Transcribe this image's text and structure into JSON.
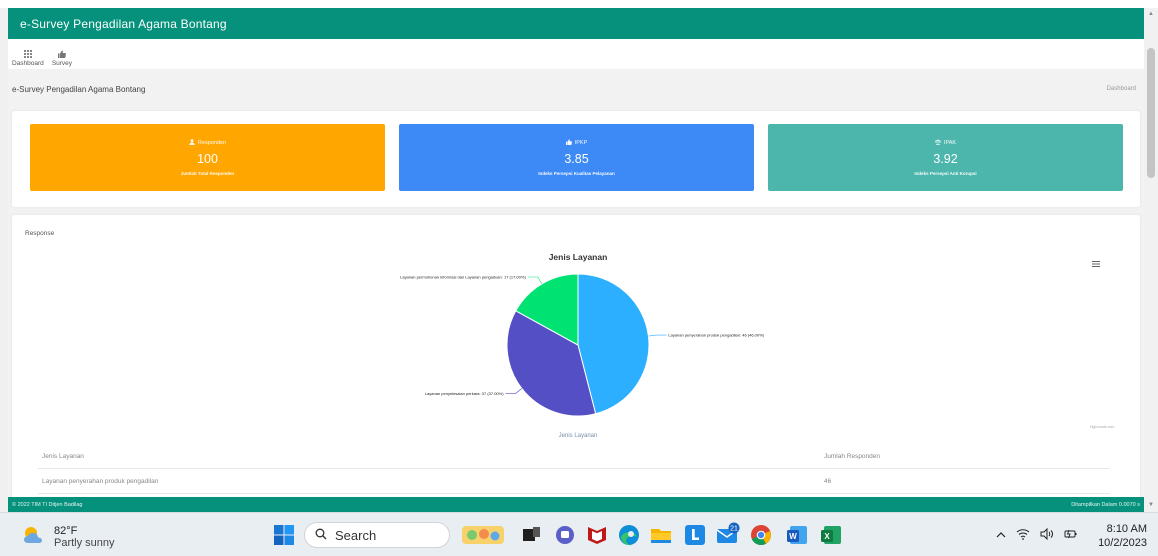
{
  "app": {
    "title": "e-Survey Pengadilan Agama Bontang"
  },
  "nav": {
    "items": [
      {
        "label": "Dashboard",
        "icon": "grid-icon"
      },
      {
        "label": "Survey",
        "icon": "thumbs-up-icon"
      }
    ]
  },
  "page": {
    "title": "e-Survey Pengadilan Agama Bontang",
    "breadcrumb": "Dashboard"
  },
  "stats": [
    {
      "heading": "Responden",
      "value": "100",
      "subtitle": "Jumlah Total Responden",
      "color": "#ffa700",
      "icon": "user-icon"
    },
    {
      "heading": "IPKP",
      "value": "3.85",
      "subtitle": "Indeks Persepsi Kualitas Pelayanan",
      "color": "#3d8af7",
      "icon": "thumbs-up-icon"
    },
    {
      "heading": "IPAK",
      "value": "3.92",
      "subtitle": "Indeks Persepsi Anti Korupsi",
      "color": "#4db6ac",
      "icon": "balance-icon"
    }
  ],
  "response": {
    "card_title": "Response",
    "credit": "Highcharts.com"
  },
  "chart_data": {
    "type": "pie",
    "title": "Jenis Layanan",
    "xlabel": "Jenis Layanan",
    "slices": [
      {
        "label": "Layanan penyerahan produk pengadilan: 46 (46.00%)",
        "name": "Layanan penyerahan produk pengadilan",
        "value": 46,
        "percent": 46.0,
        "color": "#2caffe"
      },
      {
        "label": "Layanan penyelesaian perkara: 37 (37.00%)",
        "name": "Layanan penyelesaian perkara",
        "value": 37,
        "percent": 37.0,
        "color": "#544fc5"
      },
      {
        "label": "Layanan permohonan informasi dan Layanan pengaduan: 17 (17.00%)",
        "name": "Layanan permohonan informasi dan Layanan pengaduan",
        "value": 17,
        "percent": 17.0,
        "color": "#00e272"
      }
    ]
  },
  "table": {
    "headers": [
      "Jenis Layanan",
      "Jumlah Responden"
    ],
    "rows": [
      [
        "Layanan penyerahan produk pengadilan",
        "46"
      ]
    ]
  },
  "footer": {
    "left": "© 2022 TIM TI Ditjen Badilag",
    "right": "Ditampilkan Dalam 0.0070 s"
  },
  "taskbar": {
    "weather_temp": "82°F",
    "weather_cond": "Partly sunny",
    "search_label": "Search",
    "notification_badge": "21",
    "time": "8:10 AM",
    "date": "10/2/2023"
  }
}
